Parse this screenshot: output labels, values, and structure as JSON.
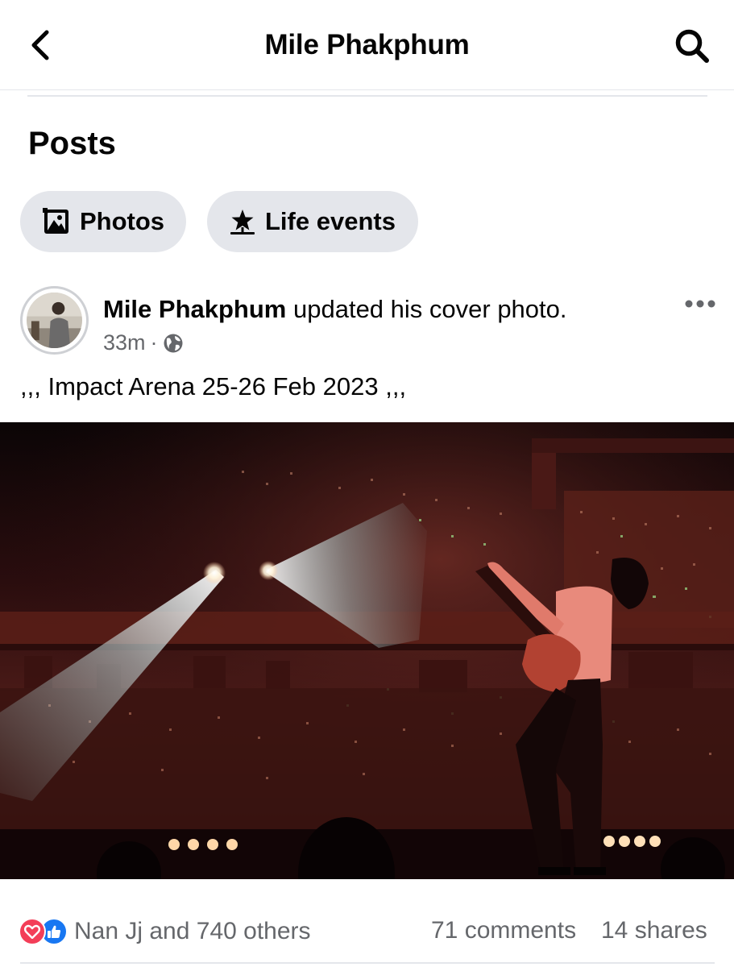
{
  "header": {
    "title": "Mile Phakphum",
    "back_icon": "chevron-left-icon",
    "search_icon": "search-icon"
  },
  "section": {
    "title": "Posts"
  },
  "filters": [
    {
      "label": "Photos",
      "icon": "photos-icon"
    },
    {
      "label": "Life events",
      "icon": "life-event-flag-icon"
    }
  ],
  "post": {
    "author": "Mile Phakphum",
    "action": " updated his cover photo.",
    "time": "33m",
    "separator": "·",
    "audience_icon": "globe-icon",
    "caption": ",,, Impact Arena 25-26 Feb 2023 ,,,",
    "photo": "cover-photo-concert"
  },
  "engagement": {
    "reactions_text": "Nan Jj and 740 others",
    "reaction_icons": [
      "love-icon",
      "like-icon"
    ],
    "comments": "71 comments",
    "shares": "14 shares"
  },
  "colors": {
    "text": "#050505",
    "secondary_text": "#65676b",
    "chip_bg": "#e4e6eb",
    "love": "#f33e58",
    "like": "#1877f2"
  }
}
